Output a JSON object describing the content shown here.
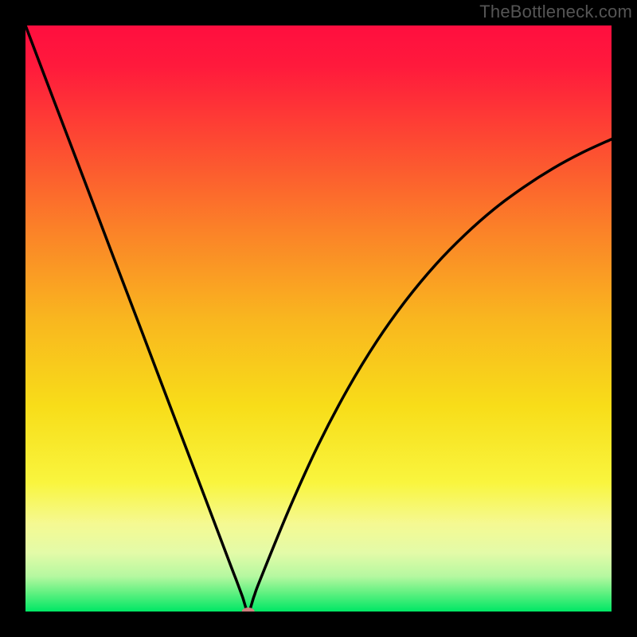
{
  "watermark": "TheBottleneck.com",
  "chart_data": {
    "type": "line",
    "title": "",
    "xlabel": "",
    "ylabel": "",
    "xlim": [
      0,
      100
    ],
    "ylim": [
      0,
      100
    ],
    "series": [
      {
        "name": "curve",
        "x": [
          0,
          5,
          10,
          15,
          20,
          25,
          30,
          35,
          36,
          37,
          38,
          39,
          40,
          45,
          50,
          55,
          60,
          65,
          70,
          75,
          80,
          85,
          90,
          95,
          100
        ],
        "y": [
          100,
          86.8,
          73.7,
          60.5,
          47.4,
          34.2,
          21.1,
          7.9,
          5.3,
          2.6,
          0,
          2.6,
          5.3,
          17.5,
          28.5,
          38.0,
          46.2,
          53.2,
          59.2,
          64.3,
          68.7,
          72.4,
          75.6,
          78.3,
          80.6
        ]
      }
    ],
    "background_gradient": {
      "stops": [
        {
          "offset": 0.0,
          "color": "#ff0e3f"
        },
        {
          "offset": 0.07,
          "color": "#ff1a3c"
        },
        {
          "offset": 0.2,
          "color": "#fd4a32"
        },
        {
          "offset": 0.35,
          "color": "#fb8228"
        },
        {
          "offset": 0.5,
          "color": "#f9b61f"
        },
        {
          "offset": 0.65,
          "color": "#f8dd19"
        },
        {
          "offset": 0.78,
          "color": "#f9f53e"
        },
        {
          "offset": 0.85,
          "color": "#f5f992"
        },
        {
          "offset": 0.9,
          "color": "#e3fba8"
        },
        {
          "offset": 0.94,
          "color": "#b5f8a0"
        },
        {
          "offset": 0.97,
          "color": "#5bf07f"
        },
        {
          "offset": 1.0,
          "color": "#00e765"
        }
      ]
    },
    "marker": {
      "x": 38,
      "y": 0,
      "rx": 8,
      "ry": 5,
      "color": "#cc7f7d"
    }
  }
}
